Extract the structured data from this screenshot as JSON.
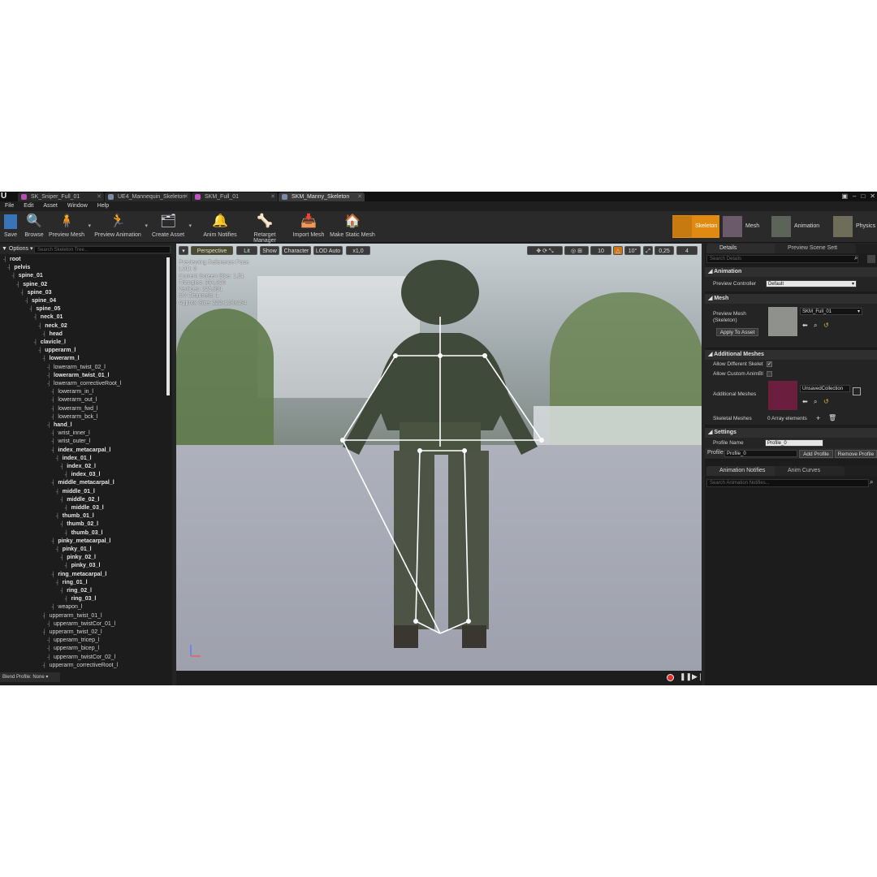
{
  "window": {
    "tabs": [
      {
        "label": "SK_Sniper_Full_01",
        "color": "#b84fb8",
        "active": false
      },
      {
        "label": "UE4_Mannequin_Skeleton",
        "color": "#7b8aa8",
        "active": false
      },
      {
        "label": "SKM_Full_01",
        "color": "#c252c2",
        "active": false
      },
      {
        "label": "SKM_Manny_Skeleton",
        "color": "#7b8aa8",
        "active": true
      }
    ]
  },
  "menu": [
    "File",
    "Edit",
    "Asset",
    "Window",
    "Help"
  ],
  "toolbar": {
    "save": "Save",
    "browse": "Browse",
    "preview_mesh": "Preview Mesh",
    "preview_animation": "Preview Animation",
    "create_asset": "Create Asset",
    "anim_notifies": "Anim Notifies",
    "retarget_manager": "Retarget Manager",
    "import_mesh": "Import Mesh",
    "make_static_mesh": "Make Static Mesh"
  },
  "modes": {
    "skeleton": "Skeleton",
    "mesh": "Mesh",
    "animation": "Animation",
    "physics": "Physics"
  },
  "skeleton_tree": {
    "options": "Options",
    "search_placeholder": "Search Skeleton Tree...",
    "bones": [
      {
        "name": "root",
        "depth": 0,
        "bold": true
      },
      {
        "name": "pelvis",
        "depth": 1,
        "bold": true
      },
      {
        "name": "spine_01",
        "depth": 2,
        "bold": true
      },
      {
        "name": "spine_02",
        "depth": 3,
        "bold": true
      },
      {
        "name": "spine_03",
        "depth": 4,
        "bold": true
      },
      {
        "name": "spine_04",
        "depth": 5,
        "bold": true
      },
      {
        "name": "spine_05",
        "depth": 6,
        "bold": true
      },
      {
        "name": "neck_01",
        "depth": 7,
        "bold": true
      },
      {
        "name": "neck_02",
        "depth": 8,
        "bold": true
      },
      {
        "name": "head",
        "depth": 9,
        "bold": true
      },
      {
        "name": "clavicle_l",
        "depth": 7,
        "bold": true
      },
      {
        "name": "upperarm_l",
        "depth": 8,
        "bold": true
      },
      {
        "name": "lowerarm_l",
        "depth": 9,
        "bold": true
      },
      {
        "name": "lowerarm_twist_02_l",
        "depth": 10,
        "bold": false
      },
      {
        "name": "lowerarm_twist_01_l",
        "depth": 10,
        "bold": true
      },
      {
        "name": "lowerarm_correctiveRoot_l",
        "depth": 10,
        "bold": false
      },
      {
        "name": "lowerarm_in_l",
        "depth": 11,
        "bold": false
      },
      {
        "name": "lowerarm_out_l",
        "depth": 11,
        "bold": false
      },
      {
        "name": "lowerarm_fwd_l",
        "depth": 11,
        "bold": false
      },
      {
        "name": "lowerarm_bck_l",
        "depth": 11,
        "bold": false
      },
      {
        "name": "hand_l",
        "depth": 10,
        "bold": true
      },
      {
        "name": "wrist_inner_l",
        "depth": 11,
        "bold": false
      },
      {
        "name": "wrist_outer_l",
        "depth": 11,
        "bold": false
      },
      {
        "name": "index_metacarpal_l",
        "depth": 11,
        "bold": true
      },
      {
        "name": "index_01_l",
        "depth": 12,
        "bold": true
      },
      {
        "name": "index_02_l",
        "depth": 13,
        "bold": true
      },
      {
        "name": "index_03_l",
        "depth": 14,
        "bold": true
      },
      {
        "name": "middle_metacarpal_l",
        "depth": 11,
        "bold": true
      },
      {
        "name": "middle_01_l",
        "depth": 12,
        "bold": true
      },
      {
        "name": "middle_02_l",
        "depth": 13,
        "bold": true
      },
      {
        "name": "middle_03_l",
        "depth": 14,
        "bold": true
      },
      {
        "name": "thumb_01_l",
        "depth": 12,
        "bold": true
      },
      {
        "name": "thumb_02_l",
        "depth": 13,
        "bold": true
      },
      {
        "name": "thumb_03_l",
        "depth": 14,
        "bold": true
      },
      {
        "name": "pinky_metacarpal_l",
        "depth": 11,
        "bold": true
      },
      {
        "name": "pinky_01_l",
        "depth": 12,
        "bold": true
      },
      {
        "name": "pinky_02_l",
        "depth": 13,
        "bold": true
      },
      {
        "name": "pinky_03_l",
        "depth": 14,
        "bold": true
      },
      {
        "name": "ring_metacarpal_l",
        "depth": 11,
        "bold": true
      },
      {
        "name": "ring_01_l",
        "depth": 12,
        "bold": true
      },
      {
        "name": "ring_02_l",
        "depth": 13,
        "bold": true
      },
      {
        "name": "ring_03_l",
        "depth": 14,
        "bold": true
      },
      {
        "name": "weapon_l",
        "depth": 11,
        "bold": false
      },
      {
        "name": "upperarm_twist_01_l",
        "depth": 9,
        "bold": false
      },
      {
        "name": "upperarm_twistCor_01_l",
        "depth": 10,
        "bold": false
      },
      {
        "name": "upperarm_twist_02_l",
        "depth": 9,
        "bold": false
      },
      {
        "name": "upperarm_tricep_l",
        "depth": 10,
        "bold": false
      },
      {
        "name": "upperarm_bicep_l",
        "depth": 10,
        "bold": false
      },
      {
        "name": "upperarm_twistCor_02_l",
        "depth": 10,
        "bold": false
      },
      {
        "name": "upperarm_correctiveRoot_l",
        "depth": 9,
        "bold": false
      }
    ],
    "blend_profile": "Blend Profile: None"
  },
  "viewport": {
    "perspective": "Perspective",
    "lit": "Lit",
    "show": "Show",
    "character": "Character",
    "lod": "LOD Auto",
    "speed": "x1,0",
    "grid_snap": "10",
    "rot_snap": "10°",
    "scale_snap": "0,25",
    "cam_speed": "4",
    "info": [
      "Previewing Reference Pose",
      "LOD: 0",
      "Current Screen Size: 1,51",
      "Triangles: 364,826",
      "Vertices: 225,891",
      "UV Channels: 1",
      "Approx Size: 222x120x194"
    ]
  },
  "details": {
    "tab_details": "Details",
    "tab_scene": "Preview Scene Sett",
    "search_placeholder": "Search Details",
    "animation_header": "Animation",
    "preview_controller_label": "Preview Controller",
    "preview_controller_value": "Default",
    "mesh_header": "Mesh",
    "preview_mesh_label": "Preview Mesh (Skeleton)",
    "preview_mesh_value": "SKM_Full_01",
    "apply_to_asset": "Apply To Asset",
    "additional_header": "Additional Meshes",
    "allow_diff": "Allow Different Skelet",
    "allow_custom": "Allow Custom AnimBl",
    "additional_meshes": "Additional Meshes",
    "additional_value": "UnsavedCollection",
    "skeletal_meshes": "Skeletal Meshes",
    "array_elements": "0 Array elements",
    "settings_header": "Settings",
    "profile_name_label": "Profile Name",
    "profile_name_value": "Profile_0",
    "profile_label": "Profile",
    "profile_value": "Profile_0",
    "add_profile": "Add Profile",
    "remove_profile": "Remove Profile"
  },
  "notifies": {
    "tab_anim_notifies": "Animation Notifies",
    "tab_anim_curves": "Anim Curves",
    "search_placeholder": "Search Animation Notifies..."
  }
}
